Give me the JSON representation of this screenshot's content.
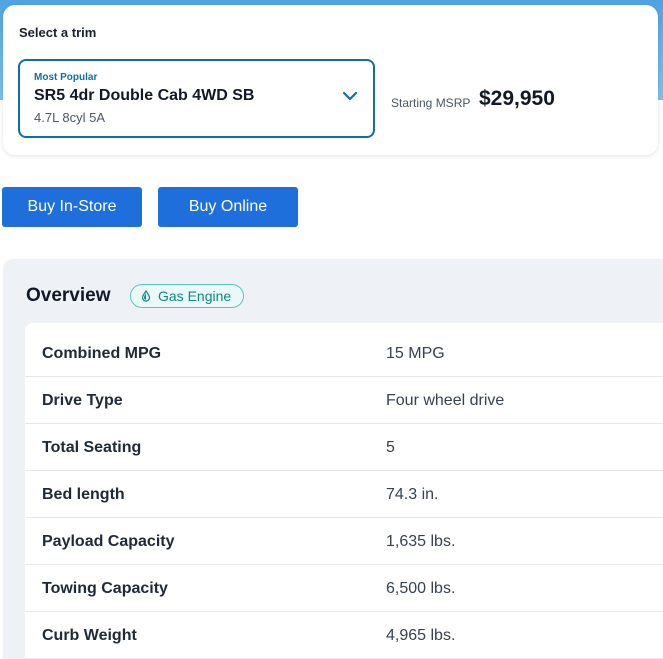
{
  "trim_selector": {
    "heading": "Select a trim",
    "badge": "Most Popular",
    "trim_name": "SR5 4dr Double Cab 4WD SB",
    "engine": "4.7L 8cyl 5A",
    "chevron_icon": "chevron-down-icon",
    "msrp_label": "Starting MSRP",
    "msrp_value": "$29,950"
  },
  "actions": {
    "buy_in_store": "Buy In-Store",
    "buy_online": "Buy Online"
  },
  "overview": {
    "title": "Overview",
    "engine_badge": "Gas Engine",
    "engine_icon": "fuel-drop-icon",
    "specs": [
      {
        "label": "Combined MPG",
        "value": "15 MPG"
      },
      {
        "label": "Drive Type",
        "value": "Four wheel drive"
      },
      {
        "label": "Total Seating",
        "value": "5"
      },
      {
        "label": "Bed length",
        "value": "74.3 in."
      },
      {
        "label": "Payload Capacity",
        "value": "1,635 lbs."
      },
      {
        "label": "Towing Capacity",
        "value": "6,500 lbs."
      },
      {
        "label": "Curb Weight",
        "value": "4,965 lbs."
      }
    ]
  },
  "colors": {
    "accent": "#0b6fa8",
    "button": "#1e6fdc",
    "engine_badge": "#0d8a84"
  }
}
